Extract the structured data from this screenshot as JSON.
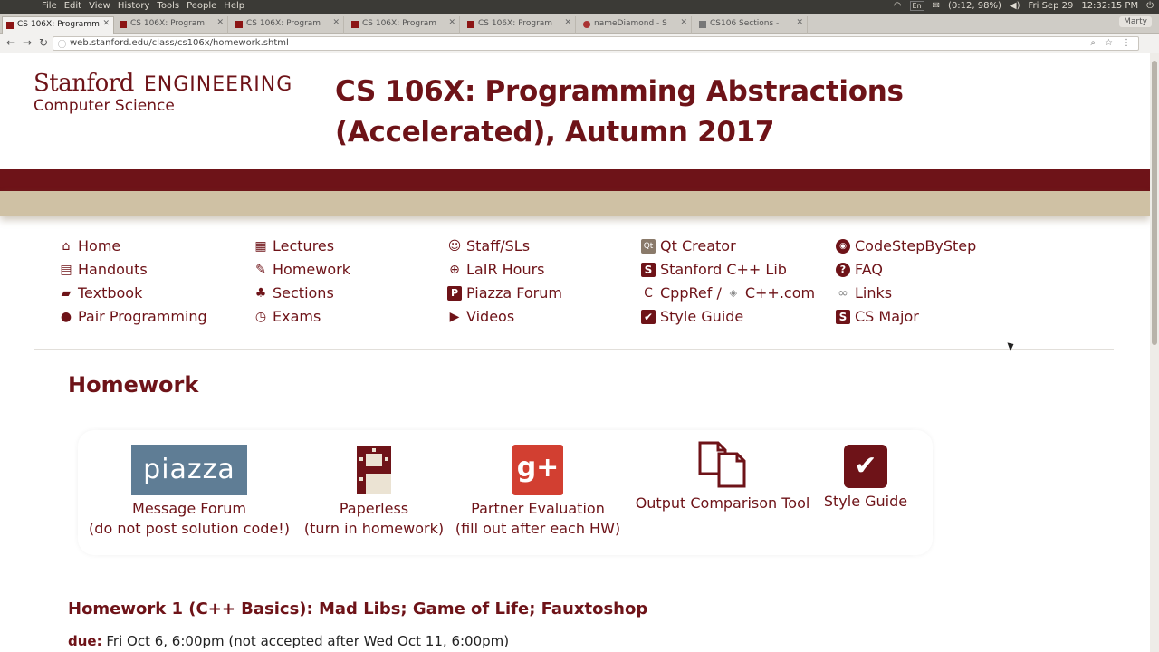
{
  "os": {
    "menus": [
      "File",
      "Edit",
      "View",
      "History",
      "Tools",
      "People",
      "Help"
    ],
    "battery": "(0:12, 98%)",
    "lang": "En",
    "datetime": "Fri Sep 29",
    "clock": "12:32:15 PM"
  },
  "browser": {
    "tabs": [
      {
        "label": "CS 106X: Programm",
        "active": true
      },
      {
        "label": "CS 106X: Program",
        "active": false
      },
      {
        "label": "CS 106X: Program",
        "active": false
      },
      {
        "label": "CS 106X: Program",
        "active": false
      },
      {
        "label": "CS 106X: Program",
        "active": false
      },
      {
        "label": "nameDiamond - S",
        "active": false
      },
      {
        "label": "CS106 Sections -",
        "active": false
      }
    ],
    "profile": "Marty",
    "url": "web.stanford.edu/class/cs106x/homework.shtml"
  },
  "header": {
    "logo_line1": "Stanford",
    "logo_eng": "ENGINEERING",
    "logo_line2": "Computer Science",
    "title": "CS 106X: Programming Abstractions (Accelerated), Autumn 2017"
  },
  "nav": {
    "col1": [
      {
        "label": "Home",
        "icon": "home-icon"
      },
      {
        "label": "Handouts",
        "icon": "book-icon"
      },
      {
        "label": "Textbook",
        "icon": "textbook-icon"
      },
      {
        "label": "Pair Programming",
        "icon": "users-icon"
      }
    ],
    "col2": [
      {
        "label": "Lectures",
        "icon": "calendar-icon"
      },
      {
        "label": "Homework",
        "icon": "edit-icon"
      },
      {
        "label": "Sections",
        "icon": "tree-icon"
      },
      {
        "label": "Exams",
        "icon": "clock-icon"
      }
    ],
    "col3": [
      {
        "label": "Staff/SLs",
        "icon": "smile-icon"
      },
      {
        "label": "LaIR Hours",
        "icon": "lifebuoy-icon"
      },
      {
        "label": "Piazza Forum",
        "icon": "piazza-icon"
      },
      {
        "label": "Videos",
        "icon": "play-icon"
      }
    ],
    "col4": [
      {
        "label": "Qt Creator",
        "icon": "qt-icon"
      },
      {
        "label": "Stanford C++ Lib",
        "icon": "stanford-s-icon"
      },
      {
        "label": "CppRef /",
        "label2": "C++.com",
        "icon": "cppref-icon"
      },
      {
        "label": "Style Guide",
        "icon": "checkbox-icon"
      }
    ],
    "col5": [
      {
        "label": "CodeStepByStep",
        "icon": "codestep-icon"
      },
      {
        "label": "FAQ",
        "icon": "question-icon"
      },
      {
        "label": "Links",
        "icon": "link-icon"
      },
      {
        "label": "CS Major",
        "icon": "cs-major-icon"
      }
    ]
  },
  "homework": {
    "heading": "Homework",
    "tools": [
      {
        "logo": "piazza",
        "line1": "Message Forum",
        "line2": "(do not post solution code!)"
      },
      {
        "logo": "paperless",
        "line1": "Paperless",
        "line2": "(turn in homework)"
      },
      {
        "logo": "g+",
        "line1": "Partner Evaluation",
        "line2": "(fill out after each HW)"
      },
      {
        "logo": "compare",
        "line1": "Output Comparison Tool",
        "line2": ""
      },
      {
        "logo": "style",
        "line1": "Style Guide",
        "line2": ""
      }
    ],
    "hw1_title": "Homework 1 (C++ Basics): Mad Libs; Game of Life; Fauxtoshop",
    "hw1_due_label": "due:",
    "hw1_due_text": "Fri Oct 6, 6:00pm (not accepted after Wed Oct 11, 6:00pm)"
  },
  "colors": {
    "cardinal": "#6e1318",
    "tan": "#cfc1a4",
    "piazza_bg": "#5f7d95",
    "gplus_red": "#d23f31"
  }
}
